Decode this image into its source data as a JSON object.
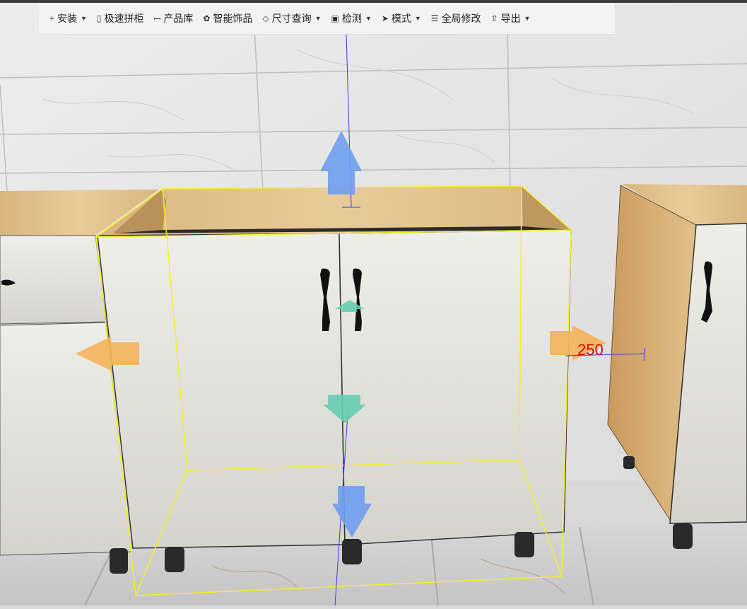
{
  "toolbar": {
    "items": [
      {
        "label": "安装",
        "icon": "plus-icon",
        "glyph": "+",
        "has_dropdown": true
      },
      {
        "label": "极速拼柜",
        "icon": "cabinet-icon",
        "glyph": "▯",
        "has_dropdown": false
      },
      {
        "label": "产品库",
        "icon": "library-icon",
        "glyph": "ꟷ",
        "has_dropdown": false
      },
      {
        "label": "智能饰品",
        "icon": "decor-icon",
        "glyph": "✿",
        "has_dropdown": false
      },
      {
        "label": "尺寸查询",
        "icon": "ruler-icon",
        "glyph": "◇",
        "has_dropdown": true
      },
      {
        "label": "检测",
        "icon": "detect-icon",
        "glyph": "▣",
        "has_dropdown": true
      },
      {
        "label": "模式",
        "icon": "cursor-icon",
        "glyph": "➤",
        "has_dropdown": true
      },
      {
        "label": "全局修改",
        "icon": "sliders-icon",
        "glyph": "☰",
        "has_dropdown": false
      },
      {
        "label": "导出",
        "icon": "export-icon",
        "glyph": "⇧",
        "has_dropdown": true
      }
    ]
  },
  "viewport": {
    "dimension_label": "250",
    "colors": {
      "selection": "#f5ee2a",
      "y_axis": "#3a3af0",
      "arrow_blue": "#6f9ff0",
      "arrow_orange": "#f4b25a",
      "arrow_teal": "#66ccb0",
      "dimension_text": "#e00000",
      "cabinet_front": "#e6e6df",
      "wood": "#e0c290"
    }
  }
}
